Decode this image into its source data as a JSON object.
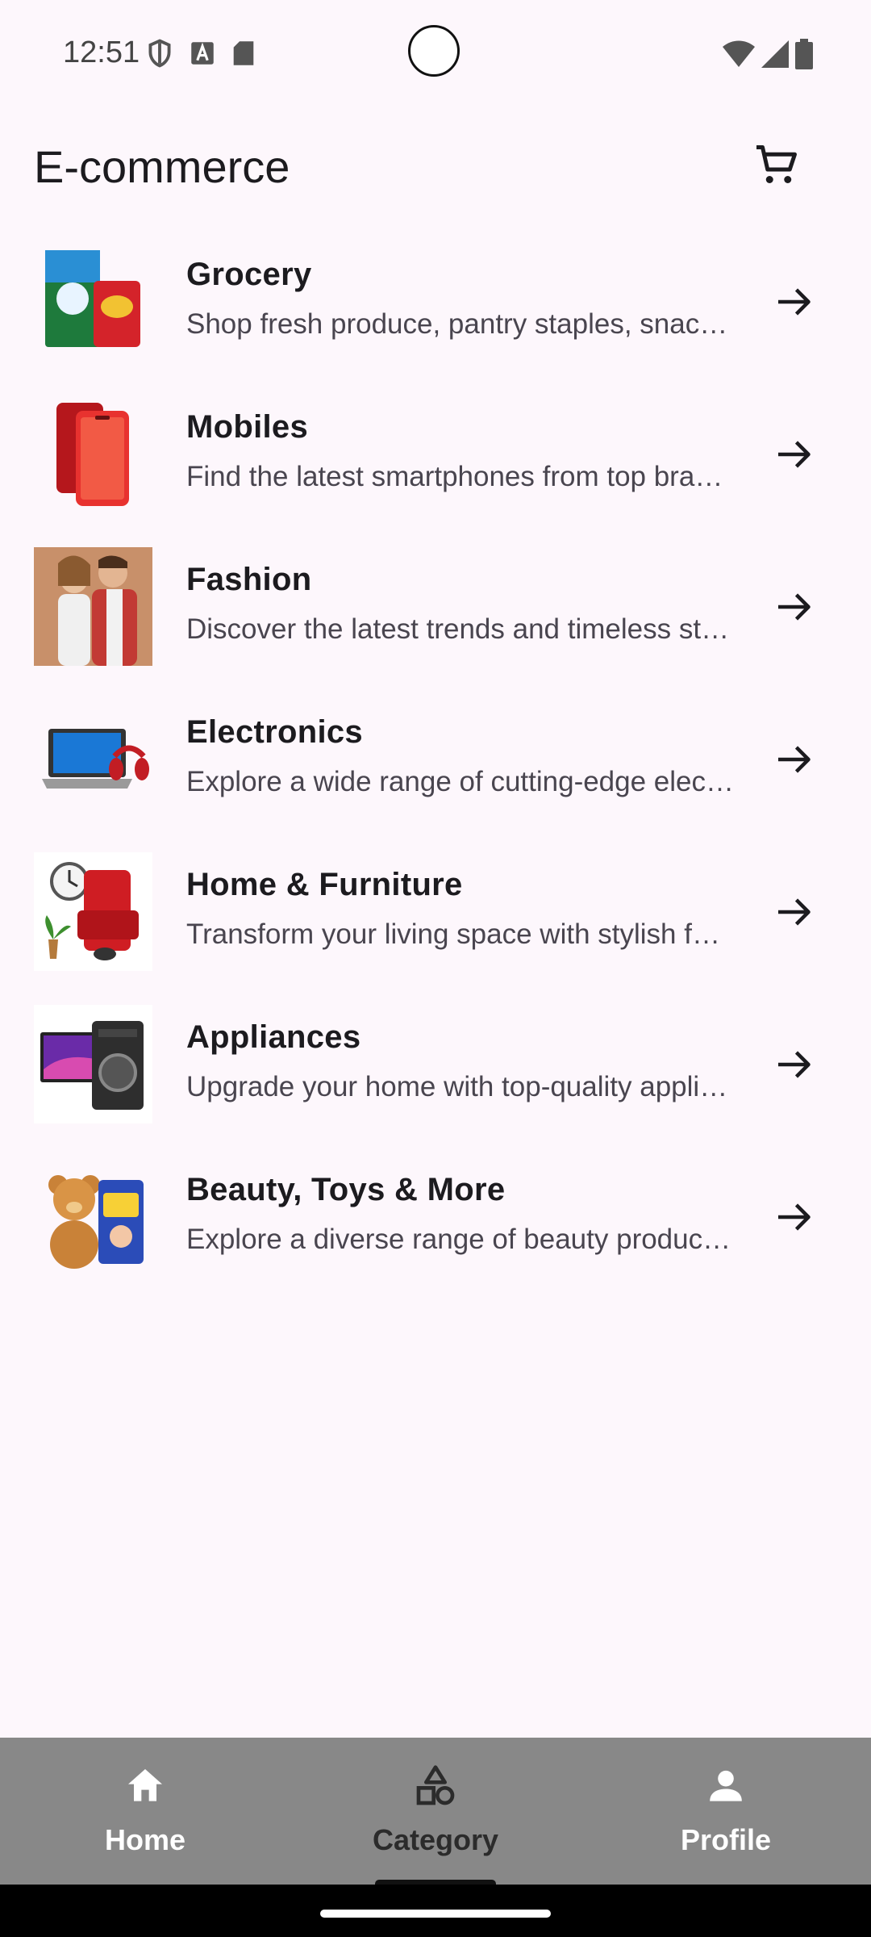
{
  "status_bar": {
    "time": "12:51",
    "icons_left": [
      "shield-icon",
      "a-badge-icon",
      "sd-card-icon"
    ],
    "icons_right": [
      "wifi-icon",
      "signal-icon",
      "battery-icon"
    ]
  },
  "app_bar": {
    "title": "E-commerce",
    "cart_icon": "cart-icon"
  },
  "categories": [
    {
      "title": "Grocery",
      "description": "Shop fresh produce, pantry staples, snacks and more"
    },
    {
      "title": "Mobiles",
      "description": "Find the latest smartphones from top brands"
    },
    {
      "title": "Fashion",
      "description": "Discover the latest trends and timeless styles"
    },
    {
      "title": "Electronics",
      "description": "Explore a wide range of cutting-edge electronics"
    },
    {
      "title": "Home & Furniture",
      "description": "Transform your living space with stylish furniture"
    },
    {
      "title": "Appliances",
      "description": "Upgrade your home with top-quality appliances"
    },
    {
      "title": "Beauty, Toys & More",
      "description": "Explore a diverse range of beauty products, toys and more"
    }
  ],
  "bottom_nav": {
    "items": [
      {
        "label": "Home",
        "icon": "home-icon"
      },
      {
        "label": "Category",
        "icon": "category-shapes-icon",
        "active": true
      },
      {
        "label": "Profile",
        "icon": "person-icon"
      }
    ]
  },
  "colors": {
    "background": "#fdf7fc",
    "nav_background": "#888888",
    "text_primary": "#1c1b1f",
    "text_secondary": "#49454f"
  }
}
